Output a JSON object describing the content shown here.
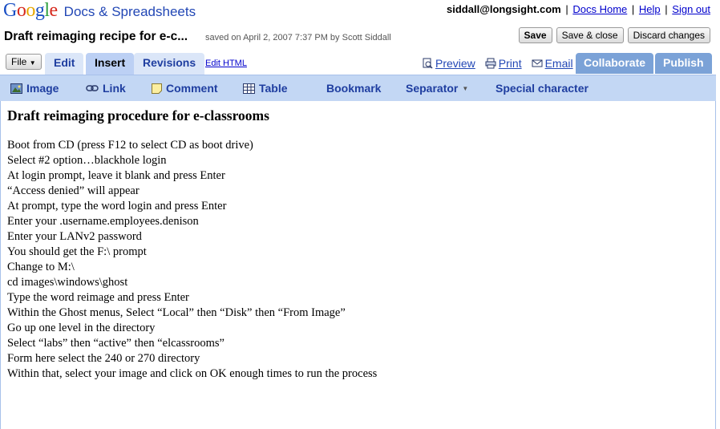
{
  "header": {
    "logo_letters": [
      {
        "ch": "G",
        "color": "#1a4fc4"
      },
      {
        "ch": "o",
        "color": "#d6281c"
      },
      {
        "ch": "o",
        "color": "#e7a700"
      },
      {
        "ch": "g",
        "color": "#1a4fc4"
      },
      {
        "ch": "l",
        "color": "#2e9f3e"
      },
      {
        "ch": "e",
        "color": "#d6281c"
      }
    ],
    "product": "Docs & Spreadsheets",
    "user_email": "siddall@longsight.com",
    "links": [
      "Docs Home",
      "Help",
      "Sign out"
    ],
    "separator": "|"
  },
  "document": {
    "title": "Draft reimaging recipe for e-c...",
    "saved_status": "saved on April 2, 2007 7:37 PM by Scott Siddall",
    "actions": {
      "save": "Save",
      "save_close": "Save & close",
      "discard": "Discard changes"
    }
  },
  "tabs": {
    "file_menu": "File",
    "items": [
      {
        "label": "Edit",
        "active": false
      },
      {
        "label": "Insert",
        "active": true
      },
      {
        "label": "Revisions",
        "active": false
      }
    ],
    "edit_html": "Edit HTML",
    "right_links": [
      {
        "label": "Preview",
        "icon": "preview-icon"
      },
      {
        "label": "Print",
        "icon": "print-icon"
      },
      {
        "label": "Email",
        "icon": "email-icon"
      }
    ],
    "collaborate": "Collaborate",
    "publish": "Publish"
  },
  "toolbar": {
    "items": [
      {
        "label": "Image",
        "icon": "image-icon"
      },
      {
        "label": "Link",
        "icon": "link-icon"
      },
      {
        "label": "Comment",
        "icon": "comment-icon"
      },
      {
        "label": "Table",
        "icon": "table-icon"
      },
      {
        "label": "Bookmark",
        "icon": ""
      },
      {
        "label": "Separator",
        "icon": "chevron-down-icon"
      },
      {
        "label": "Special character",
        "icon": ""
      }
    ]
  },
  "editor": {
    "heading": "Draft reimaging procedure for e-classrooms",
    "lines": [
      "Boot from CD (press F12 to select CD as boot drive)",
      "Select #2 option…blackhole login",
      "At login prompt, leave it blank and press Enter",
      "“Access denied” will appear",
      "At prompt, type the word login and press Enter",
      "Enter your .username.employees.denison",
      "Enter your LANv2 password",
      "You should get the F:\\ prompt",
      "Change to M:\\",
      "cd images\\windows\\ghost",
      "Type the word  reimage and press Enter",
      "Within the Ghost menus, Select “Local” then “Disk” then “From Image”",
      "Go up one level in the directory",
      "Select “labs” then “active” then “elcassrooms”",
      "Form here select the 240 or 270 directory",
      "Within that, select your image and click on OK enough times to run the process"
    ]
  }
}
